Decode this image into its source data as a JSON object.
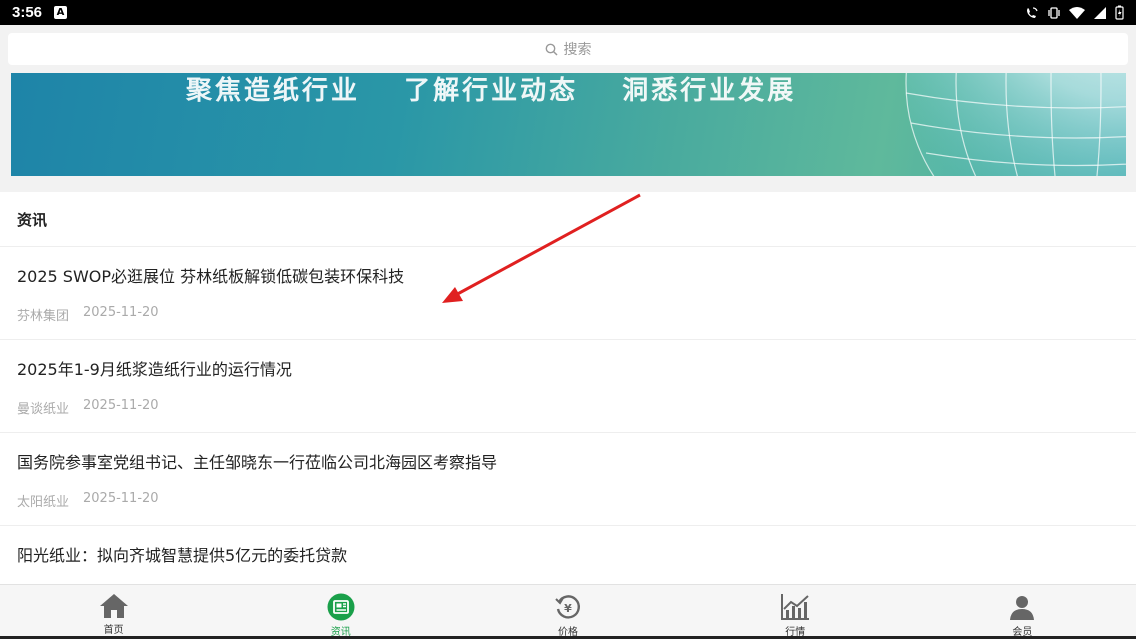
{
  "statusbar": {
    "time": "3:56",
    "notification_badge": "A"
  },
  "search": {
    "placeholder_label": "搜索"
  },
  "banner": {
    "slogan": "聚焦造纸行业  了解行业动态  洞悉行业发展"
  },
  "section": {
    "title": "资讯"
  },
  "news": [
    {
      "title": "2025 SWOP必逛展位 芬林纸板解锁低碳包装环保科技",
      "source": "芬林集团",
      "date": "2025-11-20"
    },
    {
      "title": "2025年1-9月纸浆造纸行业的运行情况",
      "source": "曼谈纸业",
      "date": "2025-11-20"
    },
    {
      "title": "国务院参事室党组书记、主任邹晓东一行莅临公司北海园区考察指导",
      "source": "太阳纸业",
      "date": "2025-11-20"
    },
    {
      "title": "阳光纸业：拟向齐城智慧提供5亿元的委托贷款",
      "source": "",
      "date": ""
    }
  ],
  "tabs": [
    {
      "label": "首页",
      "icon": "home-icon"
    },
    {
      "label": "资讯",
      "icon": "news-icon"
    },
    {
      "label": "价格",
      "icon": "price-icon"
    },
    {
      "label": "行情",
      "icon": "market-chart-icon"
    },
    {
      "label": "会员",
      "icon": "member-icon"
    }
  ],
  "colors": {
    "accent_green": "#1aa04a",
    "annotation_arrow": "#e02020"
  }
}
